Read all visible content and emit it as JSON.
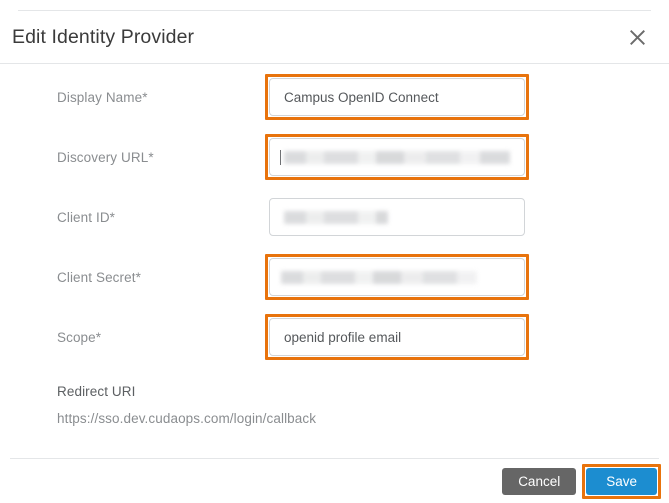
{
  "dialog": {
    "title": "Edit Identity Provider",
    "close_icon": "close-icon"
  },
  "form": {
    "fields": [
      {
        "label": "Display Name",
        "required_mark": "*",
        "value": "Campus OpenID Connect",
        "placeholder": "",
        "redacted": false,
        "highlighted": true
      },
      {
        "label": "Discovery URL",
        "required_mark": "*",
        "value": "",
        "placeholder": "",
        "redacted": true,
        "highlighted": true
      },
      {
        "label": "Client ID",
        "required_mark": "*",
        "value": "",
        "placeholder": "",
        "redacted": true,
        "highlighted": false
      },
      {
        "label": "Client Secret",
        "required_mark": "*",
        "value": "",
        "placeholder": "",
        "redacted": true,
        "highlighted": true
      },
      {
        "label": "Scope",
        "required_mark": "*",
        "value": "openid profile email",
        "placeholder": "",
        "redacted": false,
        "highlighted": true
      }
    ]
  },
  "redirect_uri": {
    "label": "Redirect URI",
    "value": "https://sso.dev.cudaops.com/login/callback"
  },
  "footer": {
    "cancel_label": "Cancel",
    "save_label": "Save"
  },
  "colors": {
    "highlight_orange": "#e8730c",
    "save_blue": "#1c8dd0",
    "cancel_gray": "#666666",
    "label_gray": "#8a8d90",
    "divider": "#e4e6e8"
  }
}
